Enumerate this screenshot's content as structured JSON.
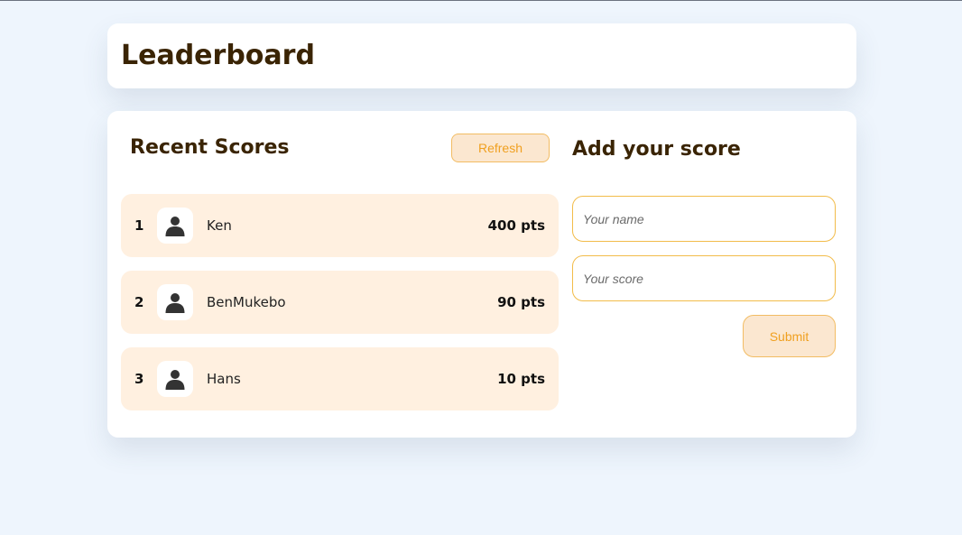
{
  "header": {
    "title": "Leaderboard"
  },
  "recent": {
    "title": "Recent Scores",
    "refresh_label": "Refresh",
    "scores": [
      {
        "rank": "1",
        "name": "Ken",
        "points": "400 pts",
        "avatar_icon": "user-icon"
      },
      {
        "rank": "2",
        "name": "BenMukebo",
        "points": "90 pts",
        "avatar_icon": "user-icon"
      },
      {
        "rank": "3",
        "name": "Hans",
        "points": "10 pts",
        "avatar_icon": "user-icon"
      }
    ]
  },
  "form": {
    "title": "Add your score",
    "name_placeholder": "Your name",
    "name_value": "",
    "score_placeholder": "Your score",
    "score_value": "",
    "submit_label": "Submit"
  },
  "colors": {
    "background": "#eef5fd",
    "title_text": "#3a2404",
    "accent": "#f0a020",
    "accent_border": "#f2bc63",
    "row_background": "#fff0e0"
  }
}
